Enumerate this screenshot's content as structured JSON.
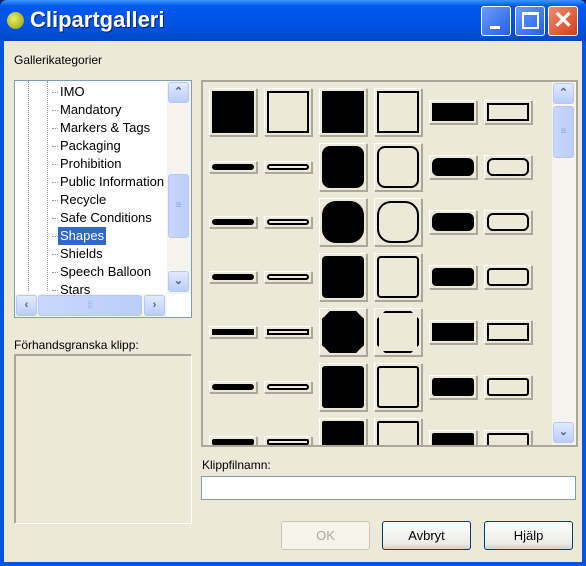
{
  "window": {
    "title": "Clipartgalleri",
    "minimize": "minimize",
    "maximize": "maximize",
    "close": "close"
  },
  "categories": {
    "label": "Gallerikategorier",
    "items": [
      "IMO",
      "Mandatory",
      "Markers & Tags",
      "Packaging",
      "Prohibition",
      "Public Information",
      "Recycle",
      "Safe Conditions",
      "Shapes",
      "Shields",
      "Speech Balloon",
      "Stars"
    ],
    "selected": "Shapes"
  },
  "preview": {
    "label": "Förhandsgranska klipp:"
  },
  "gallery": {
    "columns": 6,
    "corner_styles": [
      "square",
      "rounded-small",
      "rounded-large",
      "rounded-tiny",
      "chamfered",
      "notched",
      "inverted-round"
    ]
  },
  "filename": {
    "label": "Klippfilnamn:",
    "value": ""
  },
  "buttons": {
    "ok": "OK",
    "cancel": "Avbryt",
    "help": "Hjälp"
  }
}
